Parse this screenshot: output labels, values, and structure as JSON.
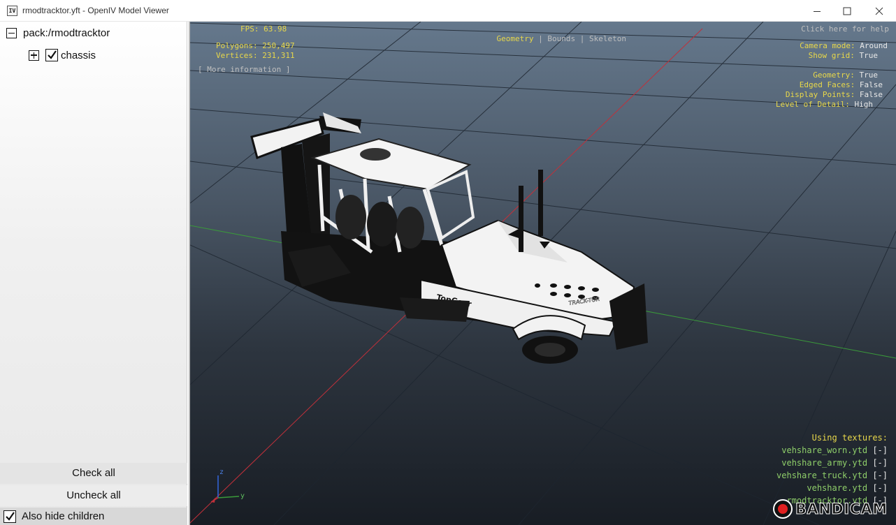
{
  "window": {
    "app_icon_text": "IV",
    "title": "rmodtracktor.yft - OpenIV Model Viewer",
    "controls": [
      "minimize",
      "maximize",
      "close"
    ]
  },
  "tree": {
    "root_label": "pack:/rmodtracktor",
    "child_label": "chassis",
    "child_checked": true
  },
  "buttons": {
    "check_all": "Check all",
    "uncheck_all": "Uncheck all",
    "also_hide_children": "Also hide children",
    "also_hide_children_checked": true
  },
  "hud": {
    "fps_label": "FPS:",
    "fps_value": "63.98",
    "polygons_label": "Polygons:",
    "polygons_value": "250,497",
    "vertices_label": "Vertices:",
    "vertices_value": "231,311",
    "more_info": "[ More information ]",
    "mode_geometry": "Geometry",
    "mode_sep1": "|",
    "mode_bounds": "Bounds",
    "mode_sep2": "|",
    "mode_skeleton": "Skeleton",
    "help": "Click here for help",
    "camera_mode_label": "Camera mode:",
    "camera_mode_value": "Around",
    "show_grid_label": "Show grid:",
    "show_grid_value": "True",
    "geometry_label": "Geometry:",
    "geometry_value": "True",
    "edged_faces_label": "Edged Faces:",
    "edged_faces_value": "False",
    "display_points_label": "Display Points:",
    "display_points_value": "False",
    "lod_label": "Level of Detail:",
    "lod_value": "High",
    "textures_title": "Using textures:",
    "textures": [
      {
        "name": "vehshare_worn.ytd",
        "action": "[-]"
      },
      {
        "name": "vehshare_army.ytd",
        "action": "[-]"
      },
      {
        "name": "vehshare_truck.ytd",
        "action": "[-]"
      },
      {
        "name": "vehshare.ytd",
        "action": "[-]"
      },
      {
        "name": "rmodtracktor.ytd",
        "action": "[-]"
      }
    ],
    "axis_z": "z",
    "axis_y": "y"
  },
  "vehicle_decals": {
    "brand": "TopGear",
    "side_text": "TRACK-TOR"
  },
  "watermark": "BANDICAM",
  "colors": {
    "hud_yellow": "#e8d84a",
    "hud_green": "#8fcf6a",
    "axis_red": "#c0303a",
    "axis_green": "#3a9a3a"
  }
}
